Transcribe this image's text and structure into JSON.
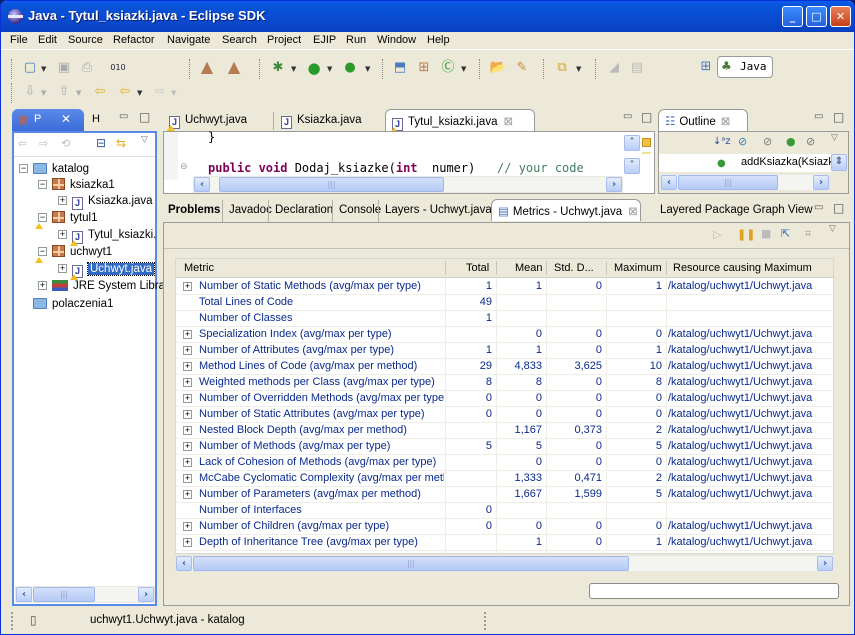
{
  "window": {
    "title": "Java - Tytul_ksiazki.java - Eclipse SDK",
    "minimize": "_",
    "maximize": "□",
    "close": "✕"
  },
  "menu": [
    "File",
    "Edit",
    "Source",
    "Refactor",
    "Navigate",
    "Search",
    "Project",
    "EJIP",
    "Run",
    "Window",
    "Help"
  ],
  "perspective": {
    "label": "Java"
  },
  "package_explorer": {
    "tabs": [
      {
        "label": "P",
        "icon": "package-explorer-icon"
      },
      {
        "label": "H",
        "icon": "hierarchy-icon"
      }
    ],
    "close": "✕",
    "tree": [
      {
        "label": "katalog",
        "type": "project",
        "expanded": true
      },
      {
        "label": "ksiazka1",
        "type": "package",
        "expanded": true
      },
      {
        "label": "Ksiazka.java",
        "type": "java-file"
      },
      {
        "label": "tytul1",
        "type": "package",
        "expanded": true,
        "warning": true
      },
      {
        "label": "Tytul_ksiazki.",
        "type": "java-file",
        "warning": true
      },
      {
        "label": "uchwyt1",
        "type": "package",
        "expanded": true,
        "warning": true
      },
      {
        "label": "Uchwyt.java",
        "type": "java-file",
        "warning": true,
        "selected": true
      },
      {
        "label": "JRE System Libra",
        "type": "library"
      },
      {
        "label": "polaczenia1",
        "type": "folder"
      }
    ]
  },
  "editor": {
    "tabs": [
      {
        "label": "Uchwyt.java"
      },
      {
        "label": "Ksiazka.java"
      },
      {
        "label": "Tytul_ksiazki.java",
        "active": true
      }
    ],
    "lines": [
      {
        "text": "}"
      },
      {
        "kw1": "public void",
        "mid": " Dodaj_ksiazke(",
        "kw2": "int",
        "rest": "  numer)   ",
        "comment": "// your code"
      }
    ]
  },
  "outline": {
    "tab": "Outline",
    "item": "addKsiazka(Ksiazk"
  },
  "bottom_tabs": [
    "Problems",
    "Javadoc",
    "Declaration",
    "Console",
    "Layers - Uchwyt.java",
    "Metrics - Uchwyt.java",
    "Layered Package Graph View"
  ],
  "metrics": {
    "columns": [
      "Metric",
      "Total",
      "Mean",
      "Std. D...",
      "Maximum",
      "Resource causing Maximum"
    ],
    "rows": [
      {
        "expand": true,
        "metric": "Number of Static Methods (avg/max per type)",
        "total": "1",
        "mean": "1",
        "std": "0",
        "max": "1",
        "res": "/katalog/uchwyt1/Uchwyt.java"
      },
      {
        "expand": false,
        "metric": "Total Lines of Code",
        "total": "49",
        "mean": "",
        "std": "",
        "max": "",
        "res": ""
      },
      {
        "expand": false,
        "metric": "Number of Classes",
        "total": "1",
        "mean": "",
        "std": "",
        "max": "",
        "res": ""
      },
      {
        "expand": true,
        "metric": "Specialization Index (avg/max per type)",
        "total": "",
        "mean": "0",
        "std": "0",
        "max": "0",
        "res": "/katalog/uchwyt1/Uchwyt.java"
      },
      {
        "expand": true,
        "metric": "Number of Attributes (avg/max per type)",
        "total": "1",
        "mean": "1",
        "std": "0",
        "max": "1",
        "res": "/katalog/uchwyt1/Uchwyt.java"
      },
      {
        "expand": true,
        "metric": "Method Lines of Code (avg/max per method)",
        "total": "29",
        "mean": "4,833",
        "std": "3,625",
        "max": "10",
        "res": "/katalog/uchwyt1/Uchwyt.java"
      },
      {
        "expand": true,
        "metric": "Weighted methods per Class (avg/max per type)",
        "total": "8",
        "mean": "8",
        "std": "0",
        "max": "8",
        "res": "/katalog/uchwyt1/Uchwyt.java"
      },
      {
        "expand": true,
        "metric": "Number of Overridden Methods (avg/max per type)",
        "total": "0",
        "mean": "0",
        "std": "0",
        "max": "0",
        "res": "/katalog/uchwyt1/Uchwyt.java"
      },
      {
        "expand": true,
        "metric": "Number of Static Attributes (avg/max per type)",
        "total": "0",
        "mean": "0",
        "std": "0",
        "max": "0",
        "res": "/katalog/uchwyt1/Uchwyt.java"
      },
      {
        "expand": true,
        "metric": "Nested Block Depth (avg/max per method)",
        "total": "",
        "mean": "1,167",
        "std": "0,373",
        "max": "2",
        "res": "/katalog/uchwyt1/Uchwyt.java"
      },
      {
        "expand": true,
        "metric": "Number of Methods (avg/max per type)",
        "total": "5",
        "mean": "5",
        "std": "0",
        "max": "5",
        "res": "/katalog/uchwyt1/Uchwyt.java"
      },
      {
        "expand": true,
        "metric": "Lack of Cohesion of Methods (avg/max per type)",
        "total": "",
        "mean": "0",
        "std": "0",
        "max": "0",
        "res": "/katalog/uchwyt1/Uchwyt.java"
      },
      {
        "expand": true,
        "metric": "McCabe Cyclomatic Complexity (avg/max per method)",
        "total": "",
        "mean": "1,333",
        "std": "0,471",
        "max": "2",
        "res": "/katalog/uchwyt1/Uchwyt.java"
      },
      {
        "expand": true,
        "metric": "Number of Parameters (avg/max per method)",
        "total": "",
        "mean": "1,667",
        "std": "1,599",
        "max": "5",
        "res": "/katalog/uchwyt1/Uchwyt.java"
      },
      {
        "expand": false,
        "metric": "Number of Interfaces",
        "total": "0",
        "mean": "",
        "std": "",
        "max": "",
        "res": ""
      },
      {
        "expand": true,
        "metric": "Number of Children (avg/max per type)",
        "total": "0",
        "mean": "0",
        "std": "0",
        "max": "0",
        "res": "/katalog/uchwyt1/Uchwyt.java"
      },
      {
        "expand": true,
        "metric": "Depth of Inheritance Tree (avg/max per type)",
        "total": "",
        "mean": "1",
        "std": "0",
        "max": "1",
        "res": "/katalog/uchwyt1/Uchwyt.java"
      }
    ]
  },
  "statusbar": {
    "text": "uchwyt1.Uchwyt.java - katalog"
  },
  "colors": {
    "titlebar": "#0a4ad0",
    "selection": "#316ac5",
    "metric_text": "#0a2a8c",
    "keyword": "#7f0055",
    "comment": "#3f7f5f"
  }
}
